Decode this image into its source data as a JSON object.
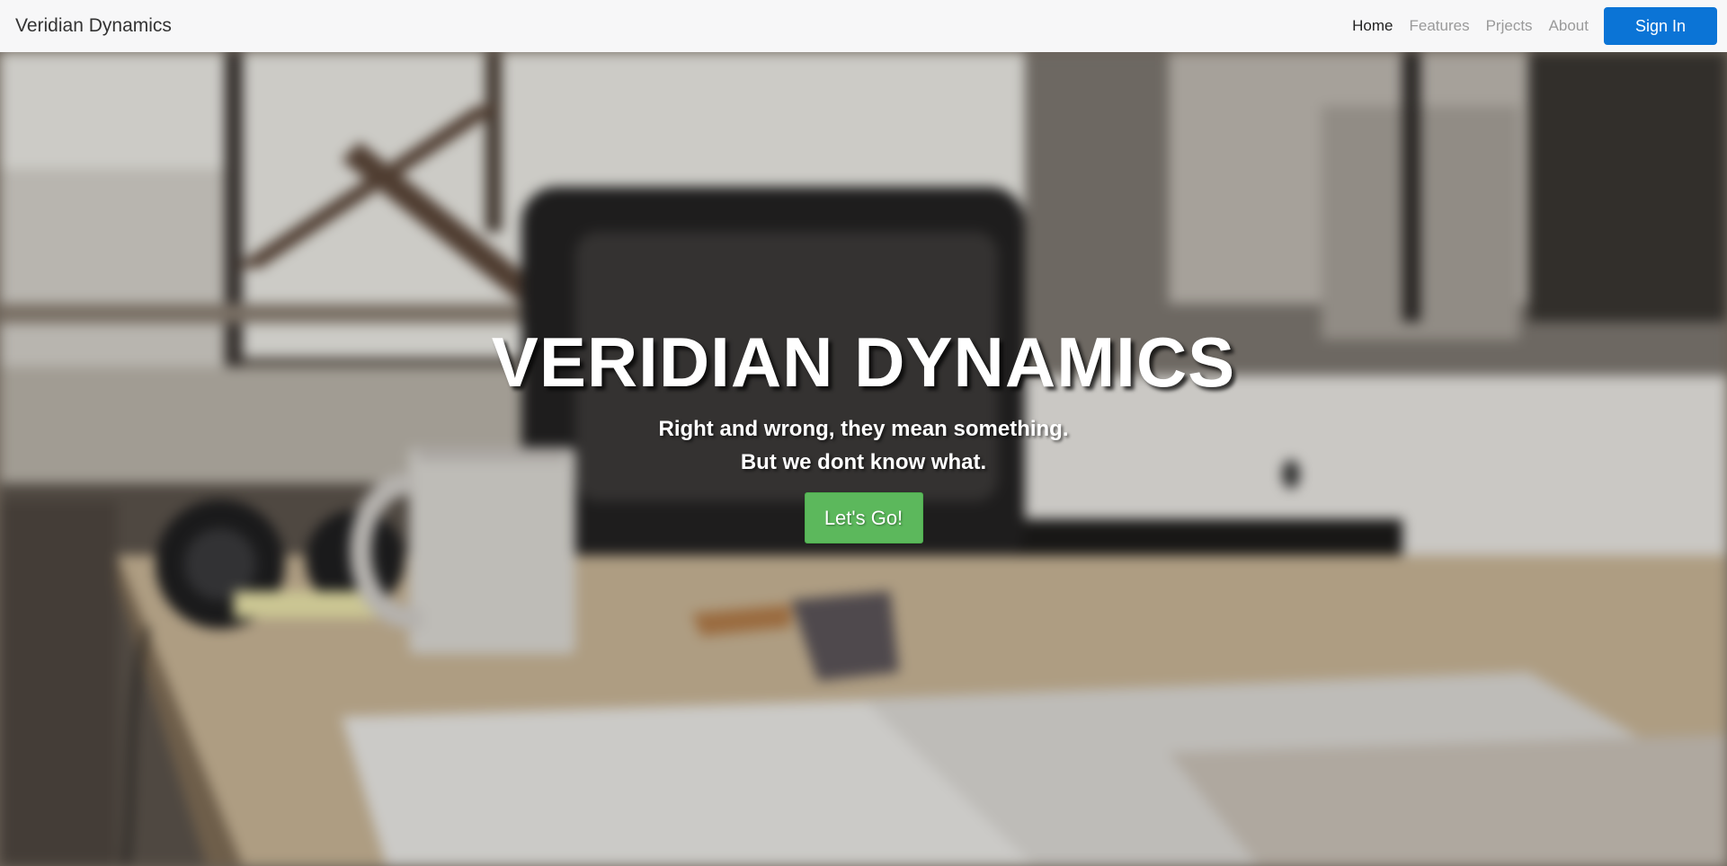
{
  "navbar": {
    "brand": "Veridian Dynamics",
    "links": [
      {
        "label": "Home",
        "active": true
      },
      {
        "label": "Features",
        "active": false
      },
      {
        "label": "Prjects",
        "active": false
      },
      {
        "label": "About",
        "active": false
      }
    ],
    "signin_label": "Sign In"
  },
  "hero": {
    "title": "VERIDIAN DYNAMICS",
    "subtitle_line1": "Right and wrong, they mean something.",
    "subtitle_line2": "But we dont know what.",
    "cta_label": "Let's Go!",
    "background_icon": "office-desk-photo"
  },
  "colors": {
    "navbar_bg": "#f7f7f8",
    "signin_bg": "#0b74d6",
    "cta_bg": "#5cb85c"
  }
}
